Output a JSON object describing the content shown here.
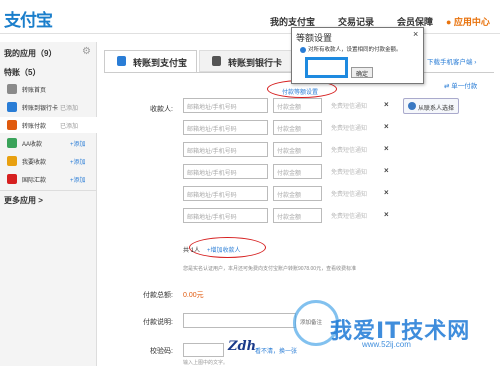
{
  "header": {
    "logo": "支付宝",
    "nav": [
      "我的支付宝",
      "交易记录",
      "会员保障"
    ],
    "app_center": "● 应用中心"
  },
  "sidebar": {
    "title": "我的应用（9）",
    "section": "特账（5）",
    "items": [
      {
        "label": "转账首页",
        "status": "",
        "add": "",
        "color": "#8a8a8a"
      },
      {
        "label": "转账到银行卡",
        "status": "已添加",
        "add": "",
        "color": "#2a7dd6"
      },
      {
        "label": "转账付款",
        "status": "已添加",
        "add": "",
        "color": "#e05a0e"
      },
      {
        "label": "AA收款",
        "status": "",
        "add": "+添加",
        "color": "#3aa35a"
      },
      {
        "label": "我要收款",
        "status": "",
        "add": "+添加",
        "color": "#e8a010"
      },
      {
        "label": "国际汇款",
        "status": "",
        "add": "+添加",
        "color": "#d62020"
      }
    ],
    "more": "更多应用 >"
  },
  "tabs": [
    {
      "label": "转账到支付宝",
      "color": "#2a7dd6"
    },
    {
      "label": "转账到银行卡",
      "color": "#555555"
    }
  ],
  "mobile_link": "下载手机客户端 ›",
  "form": {
    "fee_link": "付款等额设置",
    "one_pay": "⇄ 单一付款",
    "payee_label": "收款人:",
    "email_placeholder": "邮箱地址/手机号码",
    "amount_placeholder": "付款金额",
    "note_text": "免费短信通知",
    "delete_icon": "×",
    "contacts_button": "从联系人选择",
    "total_prefix": "共",
    "total_count": "1人",
    "add_payee": "+增加收款人",
    "notice": "您是实名认证用户，本月还可免费向支付宝账户转账9078.00元，查看收费标准",
    "total_label": "付款总额:",
    "total_value": "0.00元",
    "desc_label": "付款说明:",
    "desc_hint": "添加备注",
    "captcha_label": "校验码:",
    "captcha_image": "Zdh",
    "captcha_refresh": "看不清，换一张",
    "captcha_hint": "输入上图中的文字。"
  },
  "popup": {
    "title": "等额设置",
    "close": "×",
    "info": "对所有收款人，设置相同的付款金额。",
    "ok_label": "确定"
  },
  "watermark": {
    "text": "我爱IT技术网",
    "url": "www.52ij.com"
  }
}
